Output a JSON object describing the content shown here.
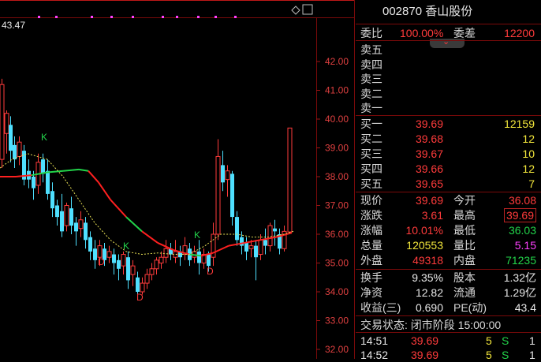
{
  "chart": {
    "top_label": "43.47",
    "price_axis": [
      "42.00",
      "41.00",
      "40.00",
      "39.00",
      "38.00",
      "37.00",
      "36.00",
      "35.00",
      "34.00",
      "33.00",
      "32.00"
    ],
    "markers": [
      {
        "text": "K",
        "color": "#22d34a"
      },
      {
        "text": "K",
        "color": "#22d34a"
      },
      {
        "text": "K",
        "color": "#22d34a"
      },
      {
        "text": "D",
        "color": "#ff3b3b"
      },
      {
        "text": "D",
        "color": "#ff3b3b"
      },
      {
        "text": "D",
        "color": "#ff3b3b"
      }
    ]
  },
  "panel": {
    "title": "002870 香山股份",
    "webi_label": "委比",
    "webi_value": "100.00%",
    "weicha_label": "委差",
    "weicha_value": "12200",
    "sells": [
      "卖五",
      "卖四",
      "卖三",
      "卖二",
      "卖一"
    ],
    "buys": [
      {
        "label": "买一",
        "price": "39.69",
        "vol": "12159"
      },
      {
        "label": "买二",
        "price": "39.68",
        "vol": "12"
      },
      {
        "label": "买三",
        "price": "39.67",
        "vol": "10"
      },
      {
        "label": "买四",
        "price": "39.66",
        "vol": "12"
      },
      {
        "label": "买五",
        "price": "39.65",
        "vol": "7"
      }
    ],
    "stats": [
      {
        "l1": "现价",
        "v1": "39.69",
        "l2": "今开",
        "v2": "36.08"
      },
      {
        "l1": "涨跌",
        "v1": "3.61",
        "l2": "最高",
        "v2": "39.69"
      },
      {
        "l1": "涨幅",
        "v1": "10.01%",
        "l2": "最低",
        "v2": "36.03"
      },
      {
        "l1": "总量",
        "v1": "120553",
        "l2": "量比",
        "v2": "5.15"
      },
      {
        "l1": "外盘",
        "v1": "49318",
        "l2": "内盘",
        "v2": "71235"
      }
    ],
    "stats2": [
      {
        "l1": "换手",
        "v1": "9.35%",
        "l2": "股本",
        "v2": "1.32亿"
      },
      {
        "l1": "净资",
        "v1": "12.82",
        "l2": "流通",
        "v2": "1.29亿"
      },
      {
        "l1": "收益(三)",
        "v1": "0.690",
        "l2": "PE(动)",
        "v2": "43.4"
      }
    ],
    "status": "交易状态: 闭市阶段 15:00:00",
    "ticks": [
      {
        "time": "14:51",
        "price": "39.69",
        "vol": "5",
        "dir": "S",
        "n": "1"
      },
      {
        "time": "14:52",
        "price": "39.69",
        "vol": "5",
        "dir": "S",
        "n": "1"
      }
    ]
  }
}
